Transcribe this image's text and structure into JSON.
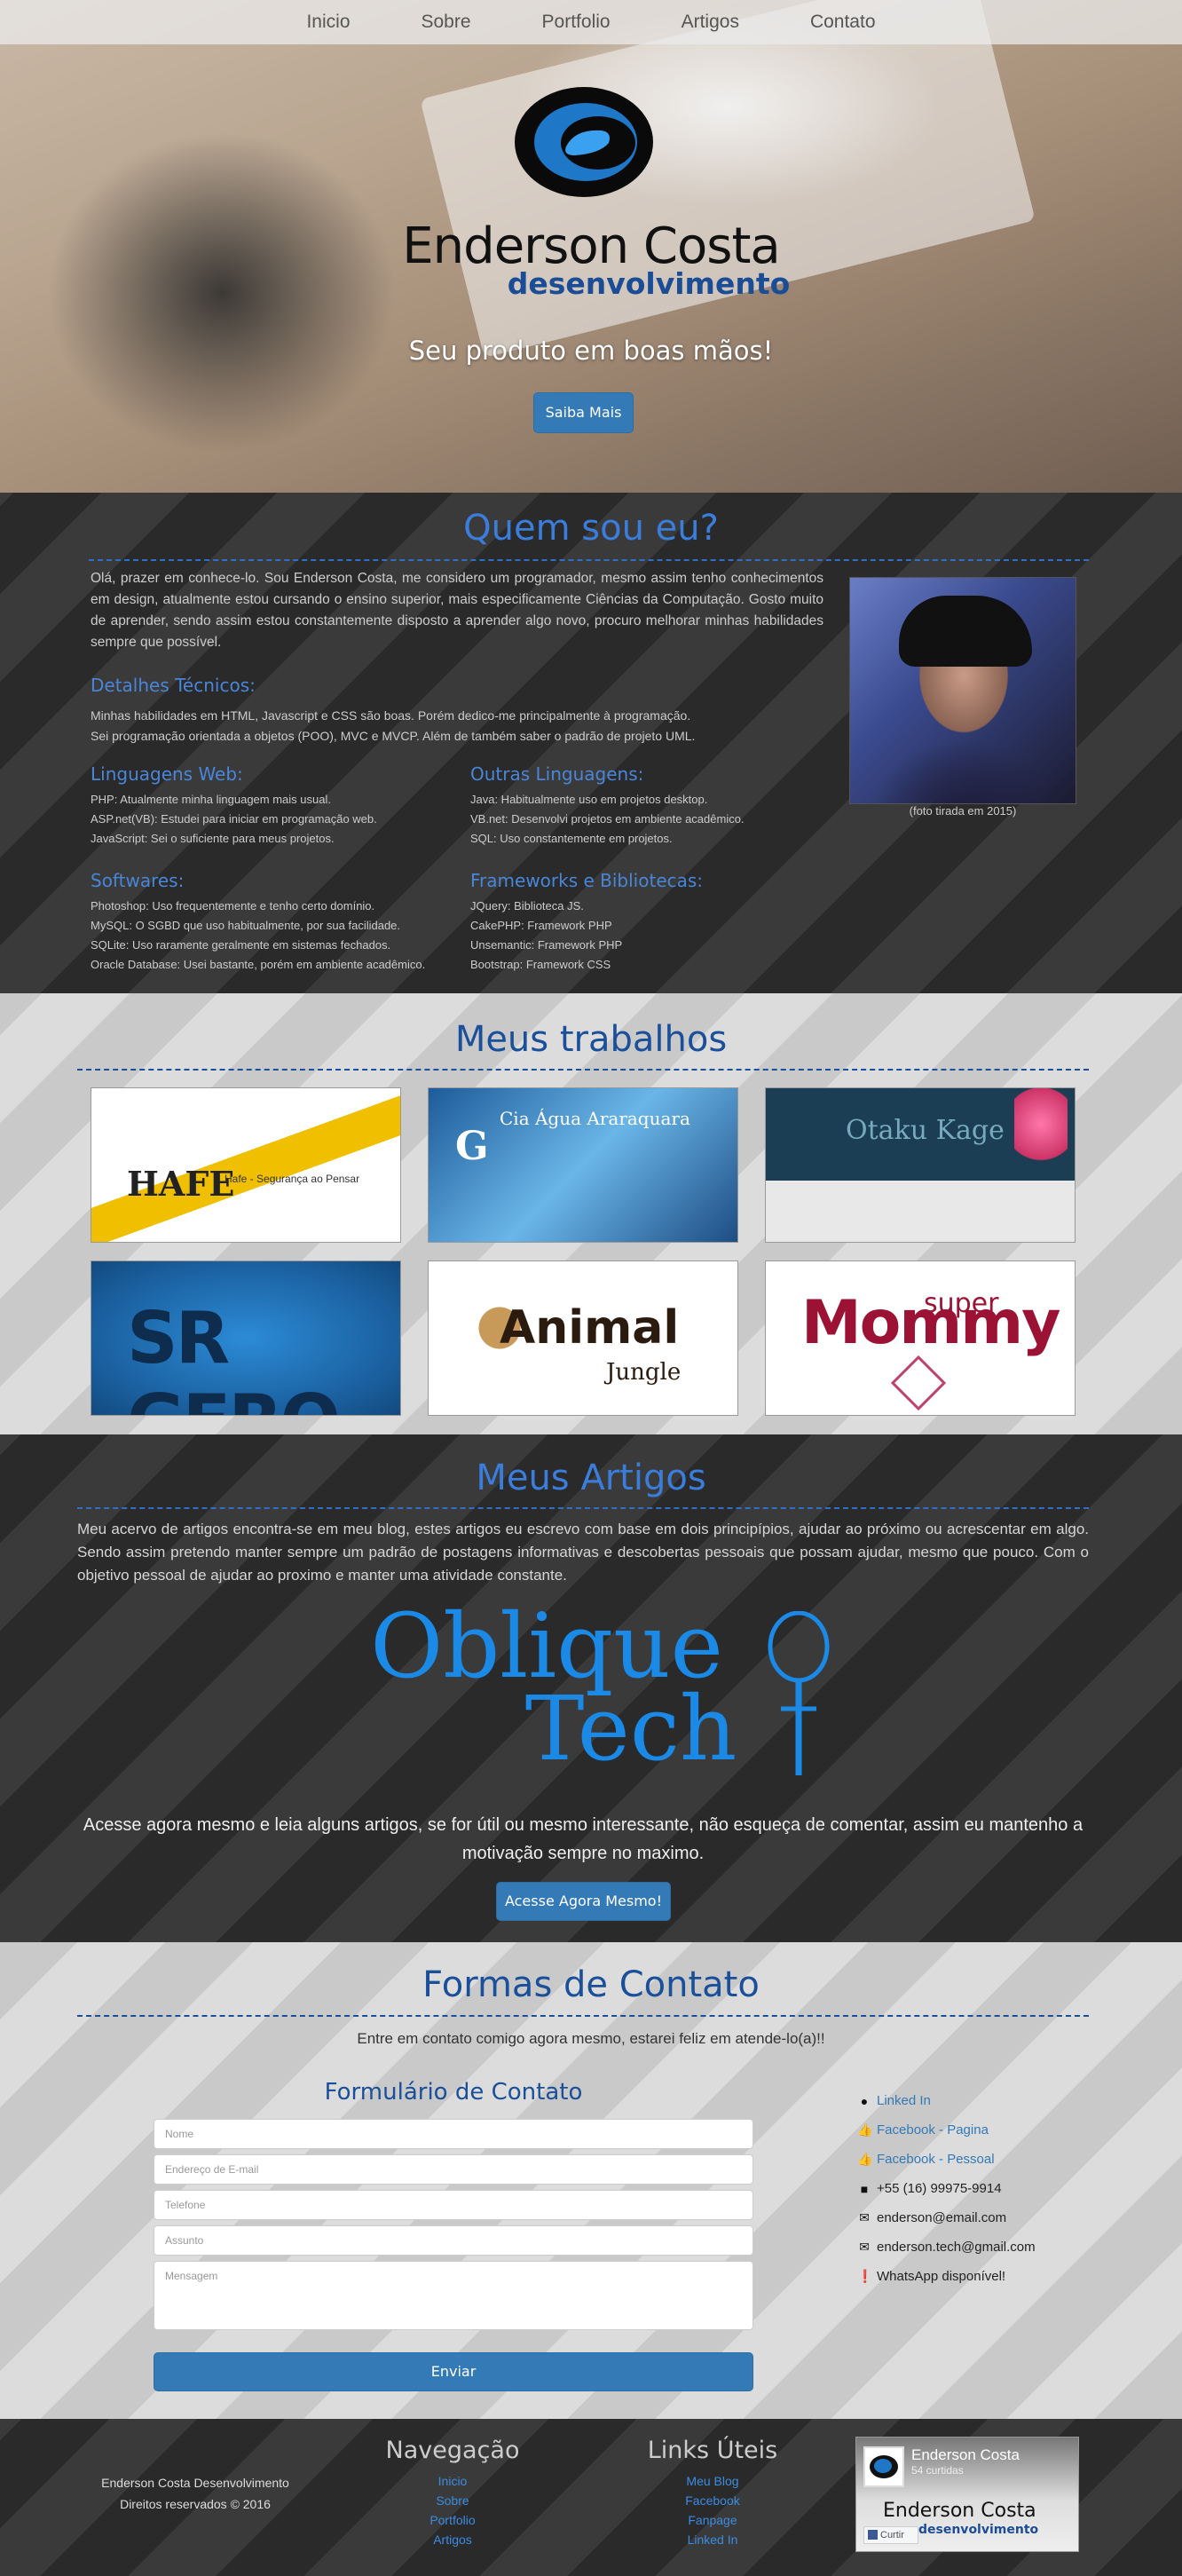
{
  "nav": {
    "items": [
      "Inicio",
      "Sobre",
      "Portfolio",
      "Artigos",
      "Contato"
    ]
  },
  "hero": {
    "brand_bold": "Enderson",
    "brand_light": "Costa",
    "brand_sub": "desenvolvimento",
    "tagline": "Seu produto em boas mãos!",
    "cta": "Saiba Mais"
  },
  "about": {
    "title": "Quem sou eu?",
    "intro": "Olá, prazer em conhece-lo. Sou Enderson Costa, me considero um programador, mesmo assim tenho conhecimentos em design, atualmente estou cursando o ensino superior, mais especificamente Ciências da Computação. Gosto muito de aprender, sendo assim estou constantemente disposto a aprender algo novo, procuro melhorar minhas habilidades sempre que possível.",
    "tech_title": "Detalhes Técnicos:",
    "tech_lines": [
      "Minhas habilidades em HTML, Javascript e CSS são boas. Porém dedico-me principalmente à programação.",
      "Sei programação orientada a objetos (POO), MVC e MVCP. Além de também saber o padrão de projeto UML."
    ],
    "web": {
      "title": "Linguagens Web:",
      "lines": [
        "PHP: Atualmente minha linguagem mais usual.",
        "ASP.net(VB): Estudei para iniciar em programação web.",
        "JavaScript: Sei o suficiente para meus projetos."
      ]
    },
    "other": {
      "title": "Outras Linguagens:",
      "lines": [
        "Java: Habitualmente uso em projetos desktop.",
        "VB.net: Desenvolvi projetos em ambiente acadêmico.",
        "SQL: Uso constantemente em projetos."
      ]
    },
    "software": {
      "title": "Softwares:",
      "lines": [
        "Photoshop: Uso frequentemente e tenho certo domínio.",
        "MySQL: O SGBD que uso habitualmente, por sua facilidade.",
        "SQLite: Uso raramente geralmente em sistemas fechados.",
        "Oracle Database: Usei bastante, porém em ambiente acadêmico."
      ]
    },
    "frameworks": {
      "title": "Frameworks e Bibliotecas:",
      "lines": [
        "JQuery: Biblioteca JS.",
        "CakePHP: Framework PHP",
        "Unsemantic: Framework PHP",
        "Bootstrap: Framework CSS"
      ]
    },
    "photo_caption": "(foto tirada em 2015)"
  },
  "works": {
    "title": "Meus trabalhos",
    "items": [
      {
        "logo": "HAFE",
        "caption": "Hafe - Segurança ao Pensar"
      },
      {
        "logo": "G",
        "caption": "Cia Água Araraquara"
      },
      {
        "logo": "Otaku Kage",
        "caption": ""
      },
      {
        "logo": "SR GERO",
        "caption": ""
      },
      {
        "logo": "Animal",
        "caption": "Jungle"
      },
      {
        "logo": "Mommy",
        "caption": "super"
      }
    ]
  },
  "articles": {
    "title": "Meus Artigos",
    "text": "Meu acervo de artigos encontra-se em meu blog, estes artigos eu escrevo com base em dois principípios, ajudar ao próximo ou acrescentar em algo. Sendo assim pretendo manter sempre um padrão de postagens informativas e descobertas pessoais que possam ajudar, mesmo que pouco. Com o objetivo pessoal de ajudar ao proximo e manter uma atividade constante.",
    "logo_line1": "Oblique",
    "logo_line2": "Tech",
    "cta_text": "Acesse agora mesmo e leia alguns artigos, se for útil ou mesmo interessante, não esqueça de comentar, assim eu mantenho a motivação sempre no maximo.",
    "cta": "Acesse Agora Mesmo!"
  },
  "contact": {
    "title": "Formas de Contato",
    "subtitle": "Entre em contato comigo agora mesmo, estarei feliz em atende-lo(a)!!",
    "form_title": "Formulário de Contato",
    "placeholders": {
      "name": "Nome",
      "email": "Endereço de E-mail",
      "phone": "Telefone",
      "subject": "Assunto",
      "message": "Mensagem"
    },
    "send": "Enviar",
    "links": [
      {
        "icon": "user-icon",
        "text": "Linked In"
      },
      {
        "icon": "thumbs-up-icon",
        "text": "Facebook - Pagina"
      },
      {
        "icon": "thumbs-up-icon",
        "text": "Facebook - Pessoal"
      }
    ],
    "info": [
      {
        "icon": "comment-icon",
        "text": "+55 (16) 99975-9914"
      },
      {
        "icon": "envelope-icon",
        "text": "enderson@email.com"
      },
      {
        "icon": "envelope-icon",
        "text": "enderson.tech@gmail.com"
      },
      {
        "icon": "exclamation-icon",
        "text": "WhatsApp disponível!"
      }
    ]
  },
  "footer": {
    "company": "Enderson Costa Desenvolvimento",
    "rights": "Direitos reservados © 2016",
    "nav_title": "Navegação",
    "nav_links": [
      "Inicio",
      "Sobre",
      "Portfolio",
      "Artigos"
    ],
    "useful_title": "Links Úteis",
    "useful_links": [
      "Meu Blog",
      "Facebook",
      "Fanpage",
      "Linked In"
    ],
    "fb_name": "Enderson Costa",
    "fb_likes": "54 curtidas",
    "fb_like_button": "Curtir",
    "fb_brand": "Enderson Costa",
    "fb_sub": "desenvolvimento"
  },
  "colors": {
    "accent": "#337ab7",
    "title_blue": "#3a7ddb",
    "dark_blue": "#1a4f9a"
  }
}
